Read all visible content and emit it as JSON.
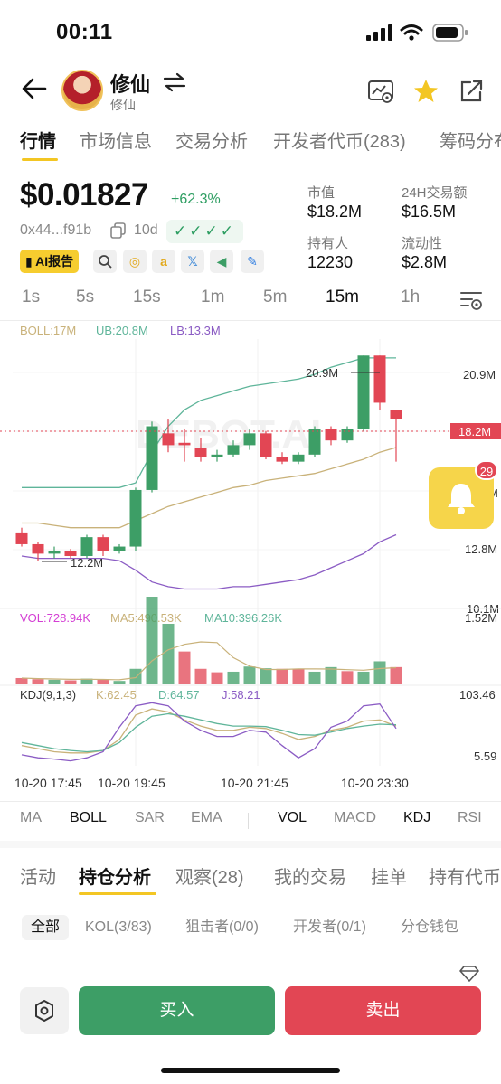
{
  "status": {
    "time": "00:11"
  },
  "header": {
    "title": "修仙",
    "subtitle": "修仙"
  },
  "main_tabs": [
    "行情",
    "市场信息",
    "交易分析",
    "开发者代币(283)",
    "筹码分布"
  ],
  "token": {
    "price": "$0.01827",
    "change": "+62.3%",
    "address": "0x44...f91b",
    "age": "10d",
    "checks": "✓✓✓✓",
    "ai_label": "AI报告"
  },
  "stats": [
    {
      "label": "市值",
      "value": "$18.2M"
    },
    {
      "label": "24H交易额",
      "value": "$16.5M"
    },
    {
      "label": "持有人",
      "value": "12230"
    },
    {
      "label": "流动性",
      "value": "$2.8M"
    }
  ],
  "intervals": [
    "1s",
    "5s",
    "15s",
    "1m",
    "5m",
    "15m",
    "1h"
  ],
  "active_interval": "15m",
  "chart": {
    "watermark": "DEBOT.AI",
    "boll_labels": {
      "boll": "BOLL:17M",
      "ub": "UB:20.8M",
      "lb": "LB:13.3M"
    },
    "price_axis": [
      "20.9M",
      "18.2M",
      "M",
      "12.8M",
      "10.1M"
    ],
    "high_label": "20.9M",
    "low_label": "12.2M",
    "vol_labels": {
      "vol": "VOL:728.94K",
      "ma5": "MA5:490.53K",
      "ma10": "MA10:396.26K"
    },
    "vol_axis": "1.52M",
    "kdj_labels": {
      "name": "KDJ(9,1,3)",
      "k": "K:62.45",
      "d": "D:64.57",
      "j": "J:58.21"
    },
    "kdj_axis": [
      "103.46",
      "5.59"
    ],
    "time_axis": [
      "10-20 17:45",
      "10-20 19:45",
      "10-20 21:45",
      "10-20 23:30"
    ],
    "bell_badge": "29"
  },
  "chart_data": {
    "type": "candlestick",
    "candles": [
      {
        "o": 13.4,
        "c": 12.9,
        "h": 13.6,
        "l": 12.8
      },
      {
        "o": 12.9,
        "c": 12.5,
        "h": 13.0,
        "l": 12.2
      },
      {
        "o": 12.5,
        "c": 12.6,
        "h": 12.8,
        "l": 12.3
      },
      {
        "o": 12.6,
        "c": 12.4,
        "h": 12.7,
        "l": 12.3
      },
      {
        "o": 12.4,
        "c": 13.2,
        "h": 13.3,
        "l": 12.3
      },
      {
        "o": 13.2,
        "c": 12.6,
        "h": 13.3,
        "l": 12.4
      },
      {
        "o": 12.6,
        "c": 12.8,
        "h": 12.9,
        "l": 12.5
      },
      {
        "o": 12.8,
        "c": 15.2,
        "h": 15.3,
        "l": 12.6
      },
      {
        "o": 15.2,
        "c": 17.9,
        "h": 18.1,
        "l": 15.1
      },
      {
        "o": 17.6,
        "c": 17.1,
        "h": 18.2,
        "l": 16.8
      },
      {
        "o": 17.2,
        "c": 17.1,
        "h": 17.8,
        "l": 16.4
      },
      {
        "o": 17.0,
        "c": 16.6,
        "h": 17.4,
        "l": 16.4
      },
      {
        "o": 16.6,
        "c": 16.7,
        "h": 16.9,
        "l": 16.4
      },
      {
        "o": 16.7,
        "c": 17.1,
        "h": 17.3,
        "l": 16.6
      },
      {
        "o": 17.1,
        "c": 17.6,
        "h": 17.8,
        "l": 16.9
      },
      {
        "o": 17.6,
        "c": 16.6,
        "h": 17.7,
        "l": 16.5
      },
      {
        "o": 16.6,
        "c": 16.4,
        "h": 16.8,
        "l": 16.3
      },
      {
        "o": 16.4,
        "c": 16.7,
        "h": 16.8,
        "l": 16.3
      },
      {
        "o": 16.7,
        "c": 17.8,
        "h": 17.9,
        "l": 16.6
      },
      {
        "o": 17.8,
        "c": 17.3,
        "h": 17.9,
        "l": 17.1
      },
      {
        "o": 17.3,
        "c": 17.8,
        "h": 17.9,
        "l": 17.2
      },
      {
        "o": 17.8,
        "c": 20.9,
        "h": 20.9,
        "l": 17.7
      },
      {
        "o": 20.9,
        "c": 18.9,
        "h": 20.9,
        "l": 18.6
      },
      {
        "o": 18.6,
        "c": 18.2,
        "h": 18.6,
        "l": 16.4
      }
    ],
    "upper_band": [
      15.3,
      15.3,
      15.3,
      15.3,
      15.3,
      15.3,
      15.3,
      15.5,
      16.8,
      17.9,
      18.6,
      19.0,
      19.2,
      19.4,
      19.6,
      19.7,
      19.8,
      19.9,
      20.1,
      20.4,
      20.6,
      20.8,
      20.8,
      20.8
    ],
    "middle_band": [
      13.8,
      13.8,
      13.7,
      13.6,
      13.6,
      13.6,
      13.6,
      13.9,
      14.2,
      14.5,
      14.7,
      14.9,
      15.1,
      15.3,
      15.4,
      15.6,
      15.7,
      15.8,
      15.9,
      16.1,
      16.3,
      16.5,
      16.8,
      17.0
    ],
    "lower_band": [
      12.4,
      12.3,
      12.3,
      12.3,
      12.3,
      12.3,
      12.2,
      11.8,
      11.3,
      11.1,
      11.0,
      11.0,
      11.0,
      11.1,
      11.1,
      11.2,
      11.3,
      11.4,
      11.6,
      11.9,
      12.2,
      12.5,
      13.0,
      13.3
    ],
    "volume_k": [
      110,
      90,
      80,
      70,
      100,
      90,
      60,
      270,
      1520,
      1050,
      570,
      270,
      210,
      220,
      310,
      280,
      270,
      260,
      220,
      300,
      230,
      220,
      400,
      300,
      580
    ],
    "volume_up": [
      false,
      false,
      true,
      false,
      true,
      false,
      true,
      true,
      true,
      true,
      false,
      false,
      false,
      true,
      true,
      true,
      false,
      false,
      true,
      true,
      false,
      true,
      true,
      false,
      false
    ],
    "kdj": {
      "k": [
        30,
        25,
        20,
        18,
        18,
        22,
        40,
        80,
        90,
        85,
        72,
        62,
        55,
        55,
        60,
        58,
        50,
        40,
        45,
        55,
        60,
        70,
        72,
        62
      ],
      "d": [
        35,
        30,
        25,
        22,
        20,
        22,
        35,
        60,
        78,
        82,
        78,
        72,
        66,
        62,
        62,
        61,
        55,
        48,
        47,
        52,
        58,
        62,
        65,
        64
      ],
      "j": [
        15,
        10,
        8,
        5,
        10,
        20,
        60,
        95,
        100,
        95,
        70,
        55,
        45,
        45,
        55,
        52,
        30,
        10,
        25,
        60,
        70,
        95,
        98,
        58
      ]
    }
  },
  "indicators": [
    "MA",
    "BOLL",
    "SAR",
    "EMA",
    "VOL",
    "MACD",
    "KDJ",
    "RSI"
  ],
  "active_indicators": [
    "BOLL",
    "VOL",
    "KDJ"
  ],
  "section_tabs": [
    "活动",
    "持仓分析",
    "观察(28)",
    "我的交易",
    "挂单",
    "持有代币"
  ],
  "filters": [
    "全部",
    "KOL(3/83)",
    "狙击者(0/0)",
    "开发者(0/1)",
    "分仓钱包"
  ],
  "actions": {
    "buy": "买入",
    "sell": "卖出"
  },
  "colors": {
    "up": "#3d9e66",
    "down": "#e24654",
    "accent": "#f3c623",
    "boll_mid": "#c9b27a",
    "boll_up": "#5fb59a",
    "boll_low": "#8b5cc4"
  }
}
